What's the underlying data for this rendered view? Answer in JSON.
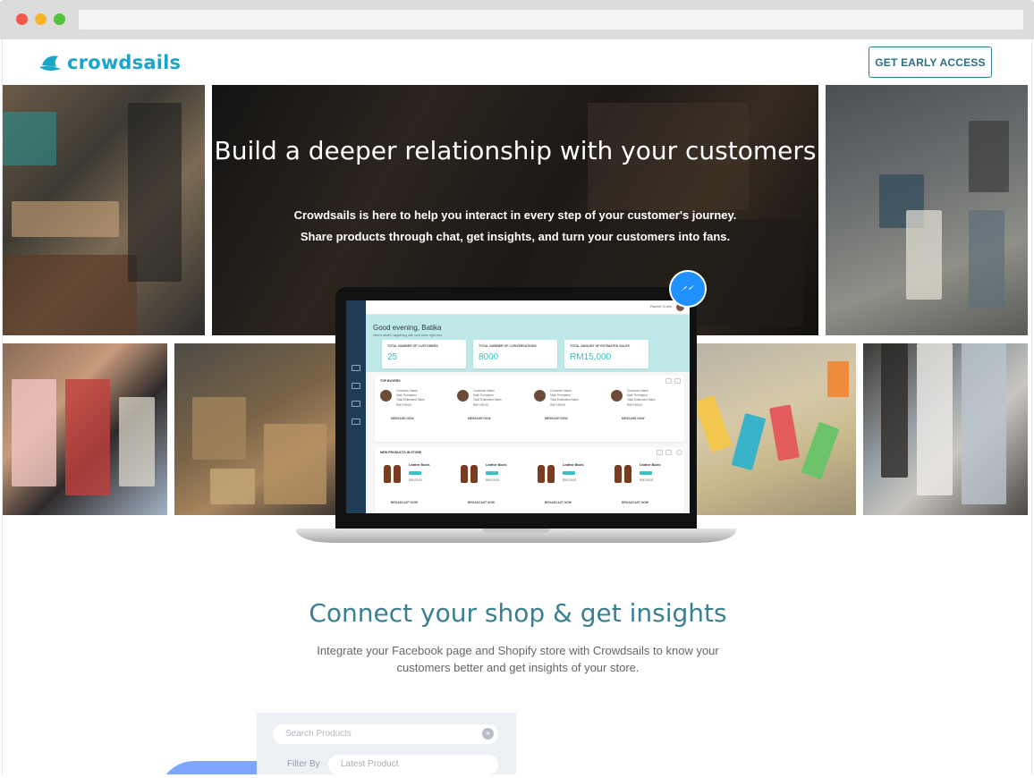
{
  "brand": {
    "name": "crowdsails",
    "accent": "#1aa6c9"
  },
  "header": {
    "cta_label": "GET EARLY ACCESS"
  },
  "hero": {
    "title": "Build a deeper relationship with your customers",
    "subtitle_line1": "Crowdsails is here to help you interact in every step of your customer's journey.",
    "subtitle_line2": "Share products through chat, get insights, and turn your customers into fans."
  },
  "dashboard": {
    "user": "Rachel Curtis",
    "greeting": "Good evening, Batika",
    "greeting_sub": "Here's what's happening with your store right now",
    "stats": [
      {
        "label": "TOTAL NUMBER OF CUSTOMERS",
        "value": "25"
      },
      {
        "label": "TOTAL NUMBER OF CONVERSATIONS",
        "value": "8000"
      },
      {
        "label": "TOTAL AMOUNT OF ESTIMATED SALES",
        "value": "RM15,000"
      }
    ],
    "top_buyers": {
      "title": "TOP BUYERS",
      "buyers": [
        {
          "label": "Customer Name",
          "name": "Matt Thompson",
          "sales_label": "Total Estimated Sales",
          "sales": "RM7199.00",
          "action": "MESSAGE NOW"
        },
        {
          "label": "Customer Name",
          "name": "Matt Thompson",
          "sales_label": "Total Estimated Sales",
          "sales": "RM7199.00",
          "action": "MESSAGE NOW"
        },
        {
          "label": "Customer Name",
          "name": "Matt Thompson",
          "sales_label": "Total Estimated Sales",
          "sales": "RM7199.00",
          "action": "MESSAGE NOW"
        },
        {
          "label": "Customer Name",
          "name": "Matt Thompson",
          "sales_label": "Total Estimated Sales",
          "sales": "RM7199.00",
          "action": "MESSAGE NOW"
        }
      ]
    },
    "new_products": {
      "title": "NEW PRODUCTS IN STORE",
      "products": [
        {
          "name": "Leather Boots",
          "price": "RM129.00",
          "action": "BROADCAST NOW"
        },
        {
          "name": "Leather Boots",
          "price": "RM129.00",
          "action": "BROADCAST NOW"
        },
        {
          "name": "Leather Boots",
          "price": "RM129.00",
          "action": "BROADCAST NOW"
        },
        {
          "name": "Leather Boots",
          "price": "RM129.00",
          "action": "BROADCAST NOW"
        }
      ]
    }
  },
  "insights": {
    "title": "Connect your shop & get insights",
    "subtitle_line1": "Integrate your Facebook page and Shopify store with Crowdsails to know your",
    "subtitle_line2": "customers better and get insights of your store.",
    "search_placeholder": "Search Products",
    "filter_label": "Filter By",
    "filter_value": "Latest Product"
  },
  "icons": [
    "sailboat-logo-icon",
    "messenger-icon",
    "clear-icon"
  ]
}
